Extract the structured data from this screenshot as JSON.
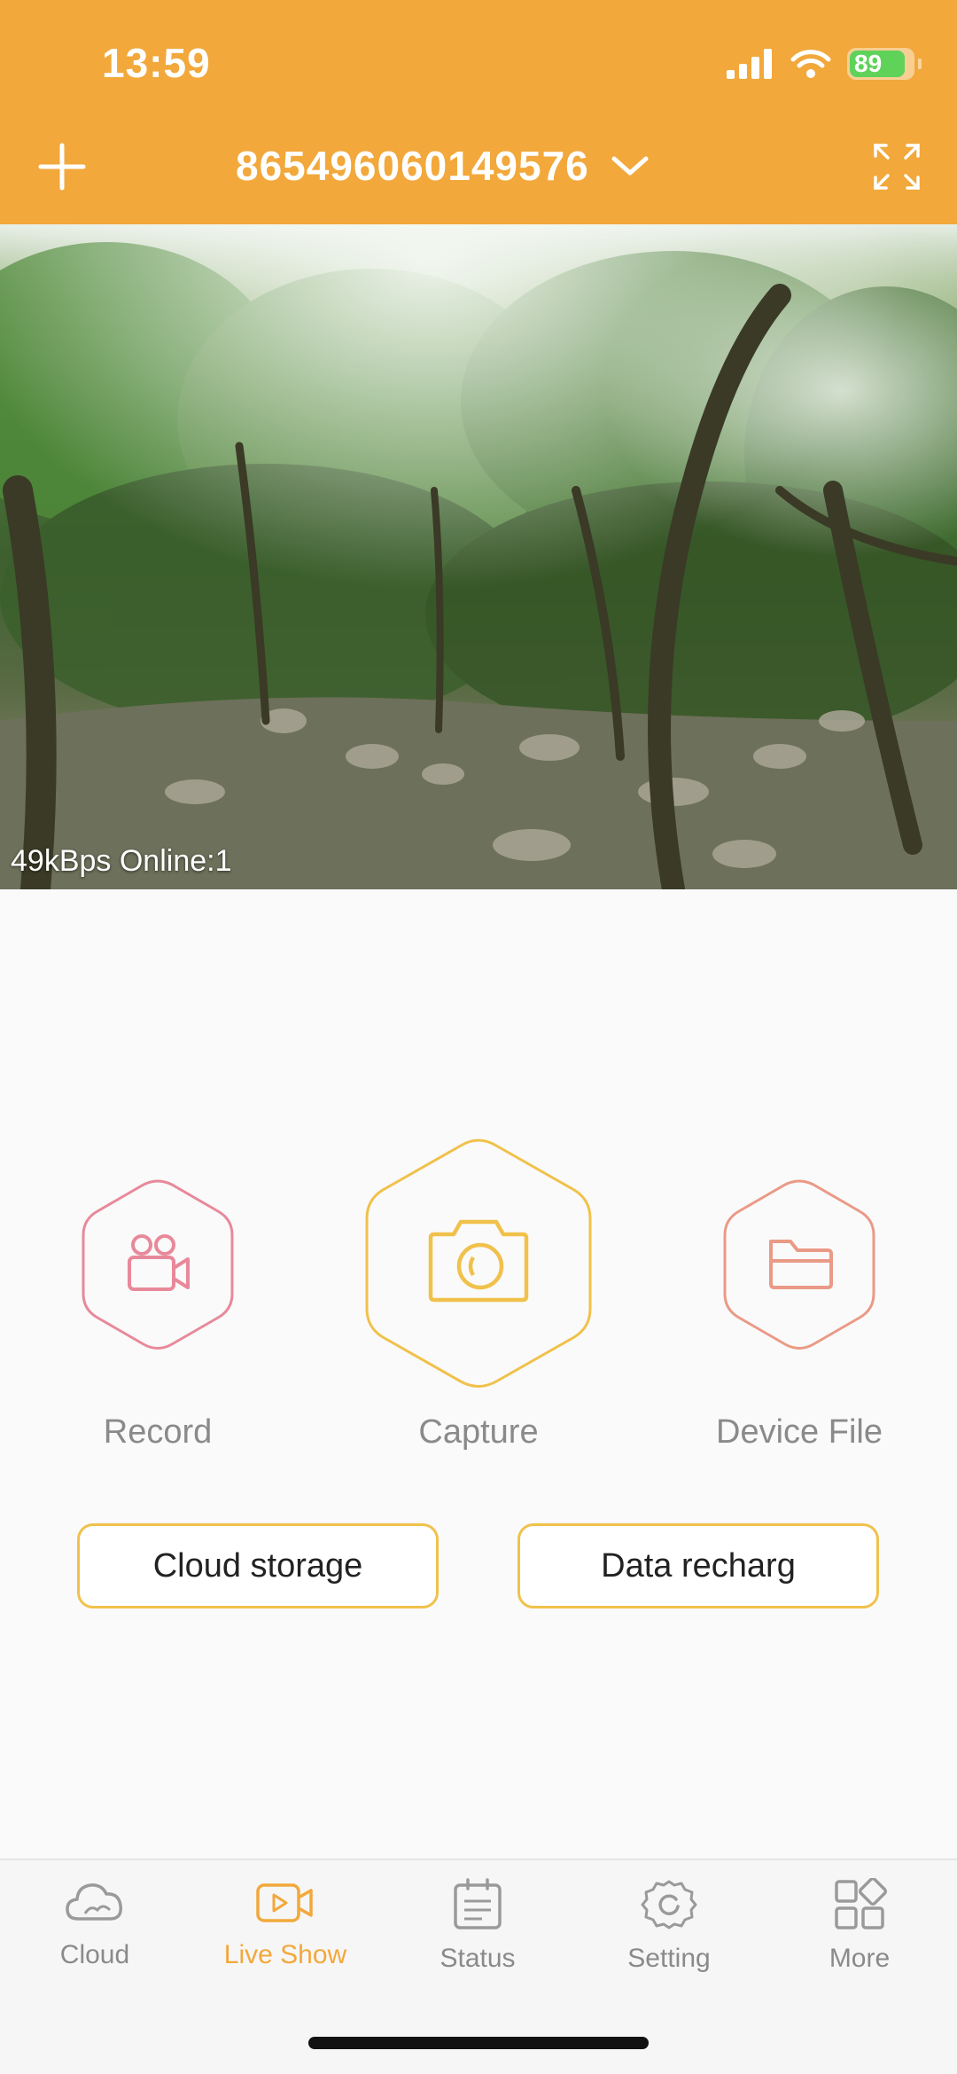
{
  "status_bar": {
    "time": "13:59",
    "battery": "89",
    "battery_level": 0.89
  },
  "header": {
    "device_id": "865496060149576"
  },
  "video": {
    "overlay_text": "49kBps Online:1"
  },
  "actions": [
    {
      "label": "Record",
      "icon": "video-camera-icon",
      "color": "#e8899a"
    },
    {
      "label": "Capture",
      "icon": "camera-icon",
      "color": "#f0c14b"
    },
    {
      "label": "Device File",
      "icon": "folder-icon",
      "color": "#ea9a86"
    }
  ],
  "buttons": {
    "cloud_storage": "Cloud storage",
    "data_recharge": "Data recharg"
  },
  "tabs": [
    {
      "label": "Cloud",
      "icon": "cloud-icon",
      "active": false
    },
    {
      "label": "Live Show",
      "icon": "live-video-icon",
      "active": true
    },
    {
      "label": "Status",
      "icon": "clipboard-icon",
      "active": false
    },
    {
      "label": "Setting",
      "icon": "gear-icon",
      "active": false
    },
    {
      "label": "More",
      "icon": "grid-icon",
      "active": false
    }
  ],
  "colors": {
    "accent": "#f2a83b",
    "active_tab": "#f2a83b",
    "inactive": "#8a8a8a"
  }
}
